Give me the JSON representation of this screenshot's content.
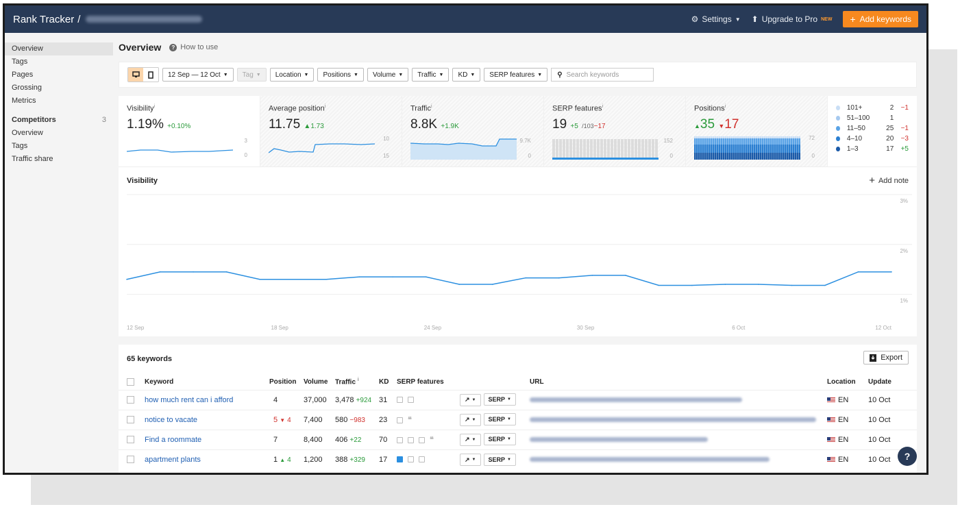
{
  "topbar": {
    "app_name": "Rank Tracker",
    "separator": "/",
    "settings_label": "Settings",
    "upgrade_label": "Upgrade to Pro",
    "new_badge": "NEW",
    "add_keywords_label": "Add keywords"
  },
  "sidebar": {
    "items": [
      "Overview",
      "Tags",
      "Pages",
      "Grossing",
      "Metrics"
    ],
    "competitors_label": "Competitors",
    "competitors_count": "3",
    "competitor_items": [
      "Overview",
      "Tags",
      "Traffic share"
    ]
  },
  "page": {
    "title": "Overview",
    "how_to_use": "How to use"
  },
  "filters": {
    "date_range": "12 Sep — 12 Oct",
    "tag": "Tag",
    "location": "Location",
    "positions": "Positions",
    "volume": "Volume",
    "traffic": "Traffic",
    "kd": "KD",
    "serp_features": "SERP features",
    "search_placeholder": "Search keywords"
  },
  "cards": {
    "visibility": {
      "title": "Visibility",
      "value": "1.19%",
      "delta": "+0.10%",
      "axis_top": "3",
      "axis_bottom": "0"
    },
    "avg_position": {
      "title": "Average position",
      "value": "11.75",
      "delta": "1.73",
      "axis_top": "10",
      "axis_bottom": "15"
    },
    "traffic": {
      "title": "Traffic",
      "value": "8.8K",
      "delta": "+1.9K",
      "axis_top": "9.7K",
      "axis_bottom": "0"
    },
    "serp": {
      "title": "SERP features",
      "value": "19",
      "delta_up": "+5",
      "of_total": "/103",
      "delta_down": "−17",
      "axis_top": "152",
      "axis_bottom": "0"
    },
    "positions": {
      "title": "Positions",
      "up": "35",
      "down": "17",
      "axis_top": "72",
      "axis_bottom": "0"
    },
    "legend": [
      {
        "label": "101+",
        "count": "2",
        "delta": "−1",
        "color": "#c9def5"
      },
      {
        "label": "51–100",
        "count": "1",
        "delta": "",
        "color": "#a6c9ef"
      },
      {
        "label": "11–50",
        "count": "25",
        "delta": "−1",
        "color": "#5aa3e6"
      },
      {
        "label": "4–10",
        "count": "20",
        "delta": "−3",
        "color": "#2b7fd1"
      },
      {
        "label": "1–3",
        "count": "17",
        "delta": "+5",
        "color": "#1a5aa8"
      }
    ]
  },
  "visibility_chart": {
    "title": "Visibility",
    "add_note": "Add note",
    "y_labels": [
      "3%",
      "2%",
      "1%"
    ],
    "x_labels": [
      "12 Sep",
      "18 Sep",
      "24 Sep",
      "30 Sep",
      "6 Oct",
      "12 Oct"
    ]
  },
  "chart_data": {
    "type": "line",
    "title": "Visibility",
    "ylim": [
      0.5,
      3
    ],
    "series": [
      {
        "values": [
          1.3,
          1.45,
          1.45,
          1.45,
          1.3,
          1.3,
          1.3,
          1.35,
          1.35,
          1.35,
          1.2,
          1.2,
          1.33,
          1.33,
          1.38,
          1.38,
          1.18,
          1.18,
          1.2,
          1.2,
          1.18,
          1.18,
          1.45,
          1.45
        ]
      }
    ]
  },
  "keywords": {
    "count_label": "65 keywords",
    "export_label": "Export",
    "columns": [
      "Keyword",
      "Position",
      "Volume",
      "Traffic",
      "KD",
      "SERP features",
      "URL",
      "Location",
      "Update"
    ],
    "rows": [
      {
        "keyword": "how much rent can i afford",
        "position": "4",
        "pos_delta": "",
        "volume": "37,000",
        "traffic": "3,478",
        "traffic_delta": "+924",
        "kd": "31",
        "location": "EN",
        "update": "10 Oct"
      },
      {
        "keyword": "notice to vacate",
        "position": "5",
        "pos_delta": "4",
        "volume": "7,400",
        "traffic": "580",
        "traffic_delta": "−983",
        "kd": "23",
        "location": "EN",
        "update": "10 Oct"
      },
      {
        "keyword": "Find a roommate",
        "position": "7",
        "pos_delta": "",
        "volume": "8,400",
        "traffic": "406",
        "traffic_delta": "+22",
        "kd": "70",
        "location": "EN",
        "update": "10 Oct"
      },
      {
        "keyword": "apartment plants",
        "position": "1",
        "pos_delta": "4",
        "volume": "1,200",
        "traffic": "388",
        "traffic_delta": "+329",
        "kd": "17",
        "location": "EN",
        "update": "10 Oct"
      }
    ],
    "serp_button": "SERP"
  },
  "help_label": "?"
}
